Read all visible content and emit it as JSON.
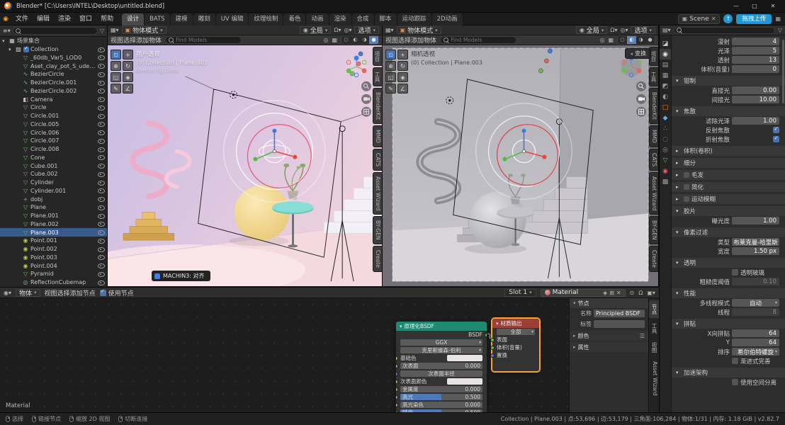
{
  "titlebar": {
    "title": "Blender* [C:\\Users\\INTEL\\Desktop\\untitled.blend]"
  },
  "topbar": {
    "menus": [
      "文件",
      "编辑",
      "渲染",
      "窗口",
      "帮助"
    ],
    "workspaces": [
      {
        "label": "设计",
        "state": "active"
      },
      {
        "label": "BATS"
      },
      {
        "label": "建模"
      },
      {
        "label": "雕刻"
      },
      {
        "label": "UV 编辑"
      },
      {
        "label": "纹理绘制"
      },
      {
        "label": "着色"
      },
      {
        "label": "动画"
      },
      {
        "label": "渲染"
      },
      {
        "label": "合成"
      },
      {
        "label": "脚本"
      },
      {
        "label": "运动跟踪"
      },
      {
        "label": "2D动画"
      }
    ],
    "scene_label": "Scene",
    "upload_label": "拖拽上传"
  },
  "outliner": {
    "items": [
      {
        "label": "场景集合",
        "icon": "scene-collection",
        "ind": "i0",
        "exp": "open",
        "noeye": "noeye"
      },
      {
        "label": "Collection",
        "icon": "collection",
        "ind": "i1",
        "exp": "open",
        "chk": "chk"
      },
      {
        "label": "_60db_Var5_LOD0",
        "icon": "mesh",
        "ind": "i2"
      },
      {
        "label": "Aset_clay_pot_S_udeja/fjw_LC",
        "icon": "mesh",
        "ind": "i2"
      },
      {
        "label": "BezierCircle",
        "icon": "curve",
        "ind": "i2"
      },
      {
        "label": "BezierCircle.001",
        "icon": "curve",
        "ind": "i2"
      },
      {
        "label": "BezierCircle.002",
        "icon": "curve",
        "ind": "i2"
      },
      {
        "label": "Camera",
        "icon": "camera",
        "ind": "i2"
      },
      {
        "label": "Circle",
        "icon": "mesh",
        "ind": "i2"
      },
      {
        "label": "Circle.001",
        "icon": "mesh",
        "ind": "i2"
      },
      {
        "label": "Circle.005",
        "icon": "mesh",
        "ind": "i2"
      },
      {
        "label": "Circle.006",
        "icon": "mesh",
        "ind": "i2"
      },
      {
        "label": "Circle.007",
        "icon": "mesh",
        "ind": "i2"
      },
      {
        "label": "Circle.008",
        "icon": "mesh",
        "ind": "i2"
      },
      {
        "label": "Cone",
        "icon": "mesh",
        "ind": "i2"
      },
      {
        "label": "Cube.001",
        "icon": "mesh",
        "ind": "i2"
      },
      {
        "label": "Cube.002",
        "icon": "mesh",
        "ind": "i2"
      },
      {
        "label": "Cylinder",
        "icon": "mesh",
        "ind": "i2"
      },
      {
        "label": "Cylinder.001",
        "icon": "mesh",
        "ind": "i2"
      },
      {
        "label": "dobj",
        "icon": "empty",
        "ind": "i2"
      },
      {
        "label": "Plane",
        "icon": "mesh",
        "ind": "i2"
      },
      {
        "label": "Plane.001",
        "icon": "mesh",
        "ind": "i2"
      },
      {
        "label": "Plane.002",
        "icon": "mesh",
        "ind": "i2"
      },
      {
        "label": "Plane.003",
        "icon": "mesh",
        "ind": "i2",
        "state": "selected"
      },
      {
        "label": "Point.001",
        "icon": "light",
        "ind": "i2"
      },
      {
        "label": "Point.002",
        "icon": "light",
        "ind": "i2"
      },
      {
        "label": "Point.003",
        "icon": "light",
        "ind": "i2"
      },
      {
        "label": "Point.004",
        "icon": "light",
        "ind": "i2"
      },
      {
        "label": "Pyramid",
        "icon": "mesh",
        "ind": "i2"
      },
      {
        "label": "ReflectionCubemap",
        "icon": "probe",
        "ind": "i2"
      }
    ]
  },
  "viewports": {
    "menus": [
      "视图",
      "选择",
      "添加",
      "物体"
    ],
    "sidebar_tabs": [
      "项目",
      "工具",
      "BlenderKit",
      "MMD",
      "CATS",
      "Asset Wizard",
      "BY-GEN",
      "Create"
    ],
    "left": {
      "mode": "物体模式",
      "orientation": "全局",
      "options_label": "选项",
      "search_placeholder": "Find Models",
      "view_label": "用户透视",
      "context_label": "(0) Collection | Plane.003",
      "status_label": "Rendering Done",
      "notification": "MACHIN3: 对齐"
    },
    "right": {
      "mode": "物体模式",
      "orientation": "全局",
      "options_label": "选项",
      "search_placeholder": "Find Models",
      "view_label": "相机透视",
      "context_label": "(0) Collection | Plane.003",
      "transform_tab": "变换"
    }
  },
  "shader": {
    "header": {
      "object_label": "物体",
      "menus": [
        "视图",
        "选择",
        "添加",
        "节点"
      ],
      "use_nodes_label": "使用节点",
      "slot_label": "Slot 1",
      "material_name": "Material"
    },
    "breadcrumb": "Material",
    "bsdf": {
      "title": "原理化BSDF",
      "out_label": "BSDF",
      "rows": [
        {
          "type": "dropdown",
          "label": "GGX"
        },
        {
          "type": "dropdown",
          "label": "克里斯滕森-伯利"
        },
        {
          "type": "color",
          "label": "基础色"
        },
        {
          "type": "value",
          "label": "次表面",
          "value": "0.000"
        },
        {
          "type": "vector",
          "label": "次表面半径"
        },
        {
          "type": "color",
          "label": "次表面颜色"
        },
        {
          "type": "value",
          "label": "金属度",
          "value": "0.000"
        },
        {
          "type": "slider",
          "label": "高光",
          "value": "0.500"
        },
        {
          "type": "value",
          "label": "高光染色",
          "value": "0.000"
        },
        {
          "type": "slider",
          "label": "糙度",
          "value": "0.500"
        }
      ]
    },
    "output": {
      "title": "材质输出",
      "rows": [
        {
          "type": "dropdown",
          "label": "全部"
        },
        {
          "type": "input-shader",
          "label": "表面"
        },
        {
          "type": "input-shader",
          "label": "体积(音量)"
        },
        {
          "type": "input-vector",
          "label": "置换"
        }
      ]
    },
    "npanel": {
      "title": "节点",
      "name_label": "名称",
      "name_value": "Principled BSDF",
      "tag_label": "标签",
      "tag_value": "",
      "color_label": "颜色",
      "attrs_label": "属性",
      "tabs": [
        {
          "label": "节点",
          "state": "active"
        },
        {
          "label": "工具"
        },
        {
          "label": "视图"
        },
        {
          "label": "Asset Wizard"
        }
      ]
    }
  },
  "properties": {
    "tabs": [
      {
        "icon": "tool"
      },
      {
        "icon": "render",
        "state": "active"
      },
      {
        "icon": "output"
      },
      {
        "icon": "view-layer"
      },
      {
        "icon": "scene"
      },
      {
        "icon": "world"
      },
      {
        "icon": "object"
      },
      {
        "icon": "modifiers"
      },
      {
        "icon": "particles"
      },
      {
        "icon": "physics"
      },
      {
        "icon": "constraints"
      },
      {
        "icon": "object-data"
      },
      {
        "icon": "material"
      },
      {
        "icon": "texture"
      }
    ],
    "rows": [
      {
        "k": "value",
        "label": "漫射",
        "value": "4"
      },
      {
        "k": "value",
        "label": "光泽",
        "value": "5"
      },
      {
        "k": "value",
        "label": "透射",
        "value": "13"
      },
      {
        "k": "value",
        "label": "体积(音量)",
        "value": "0"
      },
      {
        "k": "header-open",
        "text": "钳制"
      },
      {
        "k": "value",
        "label": "直接光",
        "value": "0.00"
      },
      {
        "k": "value",
        "label": "间接光",
        "value": "10.00"
      },
      {
        "k": "header-open",
        "text": "焦散"
      },
      {
        "k": "value",
        "label": "滤除光泽",
        "value": "1.00"
      },
      {
        "k": "check-right",
        "label": "反射焦散",
        "state": "checked"
      },
      {
        "k": "check-right",
        "label": "折射焦散",
        "state": "checked"
      },
      {
        "k": "header-closed",
        "text": "体积(卷积)"
      },
      {
        "k": "header-closed",
        "text": "细分"
      },
      {
        "k": "header-check",
        "text": "毛发",
        "state": "unchecked"
      },
      {
        "k": "header-check",
        "text": "简化",
        "state": "unchecked"
      },
      {
        "k": "header-check",
        "text": "运动模糊",
        "state": "unchecked"
      },
      {
        "k": "header-open",
        "text": "胶片"
      },
      {
        "k": "value",
        "label": "曝光度",
        "value": "1.00"
      },
      {
        "k": "header-open",
        "text": "像素过滤"
      },
      {
        "k": "dropdown",
        "label": "类型",
        "value": "布莱克曼-哈里斯"
      },
      {
        "k": "value",
        "label": "宽度",
        "value": "1.50 px"
      },
      {
        "k": "header-open",
        "text": "透明"
      },
      {
        "k": "check-label",
        "text": "透明玻璃",
        "state": "unchecked"
      },
      {
        "k": "value-dim",
        "label": "粗糙度阈值",
        "value": "0.10"
      },
      {
        "k": "header-open",
        "text": "性能"
      },
      {
        "k": "dropdown",
        "label": "多线程模式",
        "value": "自动"
      },
      {
        "k": "value-dim",
        "label": "线程",
        "value": "8"
      },
      {
        "k": "header-open",
        "text": "拼贴"
      },
      {
        "k": "value",
        "label": "X向拼贴",
        "value": "64"
      },
      {
        "k": "value",
        "label": "Y",
        "value": "64"
      },
      {
        "k": "dropdown",
        "label": "排序",
        "value": "希尔伯特螺旋"
      },
      {
        "k": "check-label",
        "text": "渐进式完善",
        "state": "unchecked"
      },
      {
        "k": "header-open",
        "text": "加速架构"
      },
      {
        "k": "check-label",
        "text": "使用空间分离",
        "state": "unchecked"
      }
    ]
  },
  "statusbar": {
    "left": [
      {
        "label": "选择"
      },
      {
        "label": "链接节点"
      },
      {
        "label": "缩放 2D 视图"
      },
      {
        "label": "切断连接"
      }
    ],
    "right": "Collection | Plane.003 | 点:53,696 | 边:53,179 | 三角面:106,284 | 物体:1/31 | 内存: 1.18 GiB | v2.82.7"
  },
  "colors": {
    "accent_blue": "#4772b3",
    "upload_blue": "#1f97d4",
    "selection_row": "#38598c",
    "bsdf_header": "#1f8a71",
    "output_header": "#9c4036",
    "node_selected_outline": "#f2a53c"
  }
}
